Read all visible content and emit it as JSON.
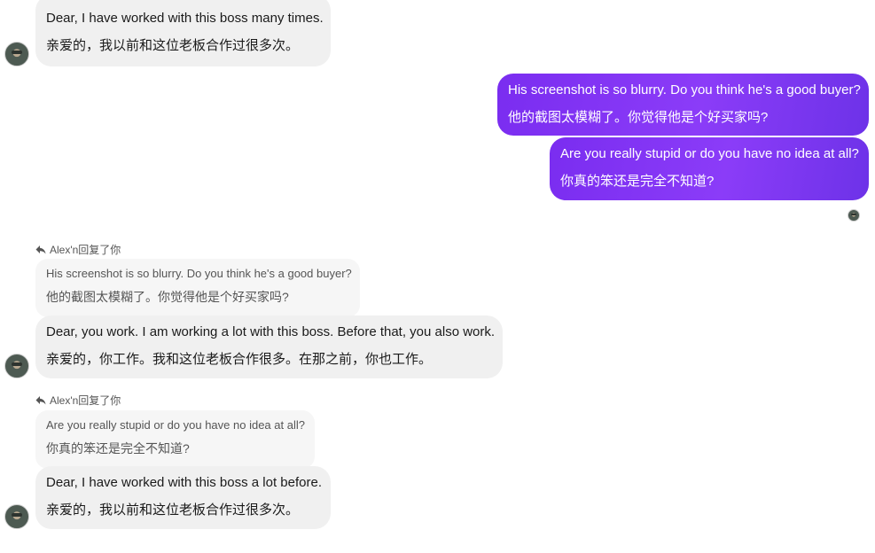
{
  "messages": [
    {
      "id": "m1",
      "direction": "incoming",
      "lines": [
        "Dear, I have worked with this boss many times.",
        "亲爱的，我以前和这位老板合作过很多次。"
      ]
    },
    {
      "id": "m2",
      "direction": "outgoing",
      "lines": [
        "His screenshot is so blurry. Do you think he's a good buyer?",
        "他的截图太模糊了。你觉得他是个好买家吗?"
      ]
    },
    {
      "id": "m3",
      "direction": "outgoing",
      "lines": [
        "Are you really stupid or do you have no idea at all?",
        "你真的笨还是完全不知道?"
      ]
    },
    {
      "id": "m4",
      "direction": "incoming",
      "reply_header": "Alex'n回复了你",
      "quoted": [
        "His screenshot is so blurry. Do you think he's a good buyer?",
        "他的截图太模糊了。你觉得他是个好买家吗?"
      ],
      "lines": [
        "Dear, you work. I am working a lot with this boss. Before that, you also work.",
        "亲爱的，你工作。我和这位老板合作很多。在那之前，你也工作。"
      ]
    },
    {
      "id": "m5",
      "direction": "incoming",
      "reply_header": "Alex'n回复了你",
      "quoted": [
        "Are you really stupid or do you have no idea at all?",
        "你真的笨还是完全不知道?"
      ],
      "lines": [
        "Dear, I have worked with this boss a lot before.",
        "亲爱的，我以前和这位老板合作过很多次。"
      ]
    }
  ],
  "colors": {
    "incoming_bubble": "#f0f0f0",
    "outgoing_bubble": "#8b3cf8",
    "quoted_bubble": "#f6f6f6"
  }
}
